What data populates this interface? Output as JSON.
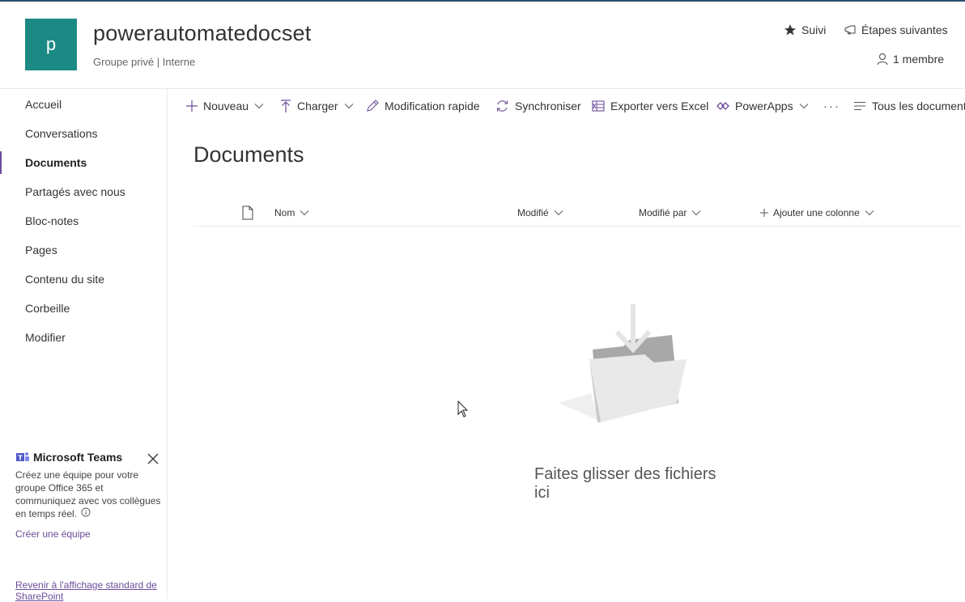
{
  "site": {
    "logo_letter": "p",
    "title": "powerautomatedocset",
    "subtitle": "Groupe privé | Interne",
    "follow": "Suivi",
    "next_steps": "Étapes suivantes",
    "members": "1 membre"
  },
  "nav": {
    "items": [
      {
        "label": "Accueil"
      },
      {
        "label": "Conversations"
      },
      {
        "label": "Documents"
      },
      {
        "label": "Partagés avec nous"
      },
      {
        "label": "Bloc-notes"
      },
      {
        "label": "Pages"
      },
      {
        "label": "Contenu du site"
      },
      {
        "label": "Corbeille"
      },
      {
        "label": "Modifier"
      }
    ],
    "active": "Documents"
  },
  "teams_card": {
    "title": "Microsoft Teams",
    "description": "Créez une équipe pour votre groupe Office 365 et communiquez avec vos collègues en temps réel.",
    "link": "Créer une équipe"
  },
  "back_classic": "Revenir à l'affichage standard de SharePoint",
  "commandbar": {
    "new": "Nouveau",
    "upload": "Charger",
    "quick_edit": "Modification rapide",
    "sync": "Synchroniser",
    "export_excel": "Exporter vers Excel",
    "powerapps": "PowerApps",
    "more": "···",
    "view": "Tous les documents"
  },
  "main": {
    "title": "Documents",
    "columns": {
      "name": "Nom",
      "modified": "Modifié",
      "modified_by": "Modifié par",
      "add_column": "Ajouter une colonne"
    },
    "empty_message": "Faites glisser des fichiers ici"
  },
  "colors": {
    "accent": "#6b4c9a",
    "logo_bg": "#1b8a85",
    "topline": "#2b4f6e"
  }
}
